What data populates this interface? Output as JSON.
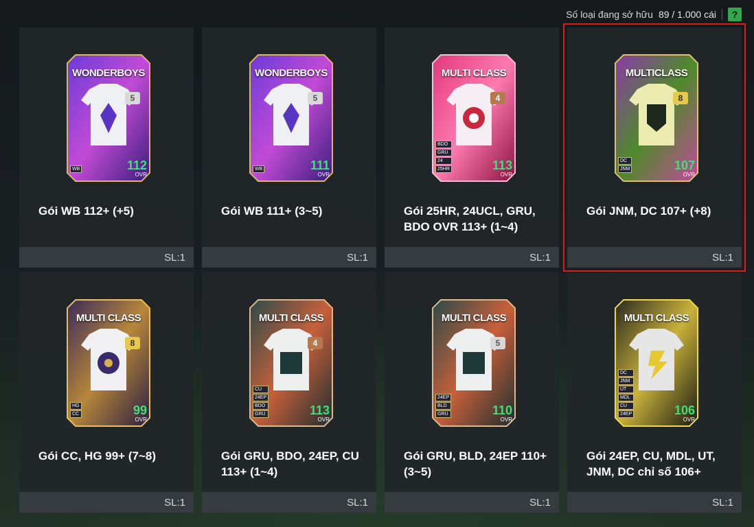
{
  "header": {
    "owned_label": "Số loại đang sở hữu",
    "owned_count": "89 / 1.000 cái",
    "help_label": "?"
  },
  "colors": {
    "accent_green": "#3fe07a",
    "selected_border": "#e01b1b",
    "help_green": "#2ea84a"
  },
  "cards": [
    {
      "title": "Gói WB 112+ (+5)",
      "qty": "SL:1",
      "pack_label": "WONDERBOYS",
      "pack_num": "5",
      "ovr": "112",
      "ovr_label": "OVR",
      "tags": [
        "WB"
      ],
      "selected": false
    },
    {
      "title": "Gói WB 111+ (3~5)",
      "qty": "SL:1",
      "pack_label": "WONDERBOYS",
      "pack_num": "5",
      "ovr": "111",
      "ovr_label": "OVR",
      "tags": [
        "WB"
      ],
      "selected": false
    },
    {
      "title": "Gói 25HR, 24UCL, GRU, BDO OVR 113+ (1~4)",
      "qty": "SL:1",
      "pack_label": "MULTI CLASS",
      "pack_num": "4",
      "ovr": "113",
      "ovr_label": "OVR",
      "tags": [
        "BDO",
        "GRU",
        "24",
        "25HR"
      ],
      "selected": false
    },
    {
      "title": "Gói JNM, DC 107+ (+8)",
      "qty": "SL:1",
      "pack_label": "MULTICLASS",
      "pack_num": "8",
      "ovr": "107",
      "ovr_label": "OVR",
      "tags": [
        "DC",
        "JNM"
      ],
      "selected": true
    },
    {
      "title": "Gói CC, HG 99+ (7~8)",
      "qty": "SL:1",
      "pack_label": "MULTI CLASS",
      "pack_num": "8",
      "ovr": "99",
      "ovr_label": "OVR",
      "tags": [
        "HG",
        "CC"
      ],
      "selected": false
    },
    {
      "title": "Gói GRU, BDO, 24EP, CU 113+ (1~4)",
      "qty": "SL:1",
      "pack_label": "MULTI CLASS",
      "pack_num": "4",
      "ovr": "113",
      "ovr_label": "OVR",
      "tags": [
        "CU",
        "24EP",
        "BDO",
        "GRU"
      ],
      "selected": false
    },
    {
      "title": "Gói GRU, BLD, 24EP 110+ (3~5)",
      "qty": "SL:1",
      "pack_label": "MULTI CLASS",
      "pack_num": "5",
      "ovr": "110",
      "ovr_label": "OVR",
      "tags": [
        "24EP",
        "BLD",
        "GRU"
      ],
      "selected": false
    },
    {
      "title": "Gói 24EP, CU, MDL, UT, JNM, DC chỉ số 106+",
      "qty": "SL:1",
      "pack_label": "MULTI CLASS",
      "pack_num": "",
      "ovr": "106",
      "ovr_label": "OVR",
      "tags": [
        "DC",
        "JNM",
        "UT",
        "MDL",
        "CU",
        "24EP"
      ],
      "selected": false
    }
  ]
}
